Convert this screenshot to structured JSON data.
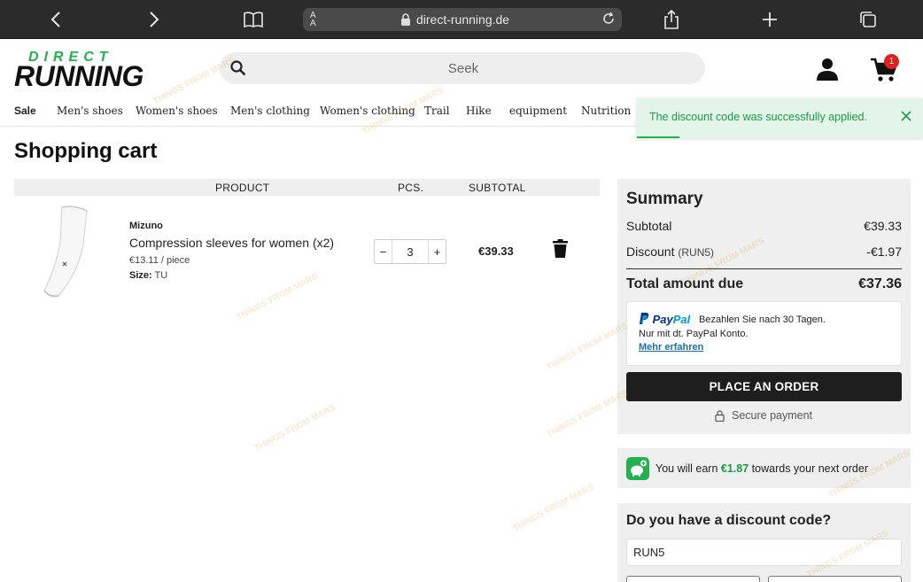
{
  "browser": {
    "text_size_label": "A",
    "url": "direct-running.de"
  },
  "header": {
    "logo_top": "DIRECT",
    "logo_bottom": "RUNNING",
    "search_placeholder": "Seek",
    "cart_count": "1"
  },
  "nav": {
    "items": [
      "Sale",
      "Men's shoes",
      "Women's shoes",
      "Men's clothing",
      "Women's clothing",
      "Trail",
      "Hike",
      "equipment",
      "Nutrition"
    ]
  },
  "toast": {
    "message": "The discount code was successfully applied."
  },
  "page": {
    "title": "Shopping cart"
  },
  "cart": {
    "columns": {
      "product": "PRODUCT",
      "pcs": "PCS.",
      "subtotal": "SUBTOTAL"
    },
    "items": [
      {
        "brand": "Mizuno",
        "name": "Compression sleeves for women (x2)",
        "unit_price": "€13.11 / piece",
        "size_label": "Size:",
        "size_value": "TU",
        "qty_minus": "−",
        "quantity": "3",
        "qty_plus": "+",
        "line_total": "€39.33"
      }
    ]
  },
  "summary": {
    "title": "Summary",
    "subtotal_label": "Subtotal",
    "subtotal_value": "€39.33",
    "discount_label": "Discount",
    "discount_code": "(RUN5)",
    "discount_value": "-€1.97",
    "total_label": "Total amount due",
    "total_value": "€37.36",
    "paypal": {
      "logo_a": "Pay",
      "logo_b": "Pal",
      "line1": "Bezahlen Sie nach 30 Tagen.",
      "line2": "Nur mit dt. PayPal Konto.",
      "link": "Mehr erfahren"
    },
    "order_button": "PLACE AN ORDER",
    "secure_label": "Secure payment"
  },
  "loyalty": {
    "prefix": "You will earn",
    "amount": "€1.87",
    "suffix": "towards your next order"
  },
  "discount": {
    "title": "Do you have a discount code?",
    "value": "RUN5"
  },
  "watermark": {
    "text": "THINGS FROM MARS"
  },
  "colors": {
    "brand_green": "#22b14c",
    "badge_red": "#e02020",
    "dark_button": "#1e1e1e",
    "panel_gray": "#efefef"
  }
}
